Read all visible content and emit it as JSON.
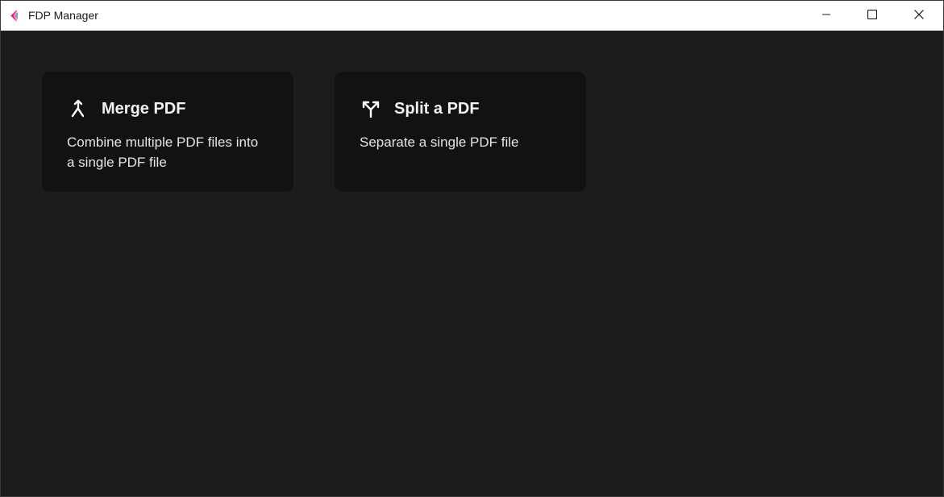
{
  "window": {
    "title": "FDP Manager",
    "icons": {
      "app": "app-logo-icon",
      "minimize": "minimize-icon",
      "maximize": "maximize-icon",
      "close": "close-icon"
    }
  },
  "cards": [
    {
      "icon": "merge-icon",
      "title": "Merge PDF",
      "description": "Combine multiple PDF files into a single PDF file"
    },
    {
      "icon": "split-icon",
      "title": "Split a PDF",
      "description": "Separate a single PDF file"
    }
  ],
  "colors": {
    "background": "#1c1c1e",
    "card": "#121214",
    "titlebar": "#ffffff",
    "text": "#f2f2f2"
  }
}
